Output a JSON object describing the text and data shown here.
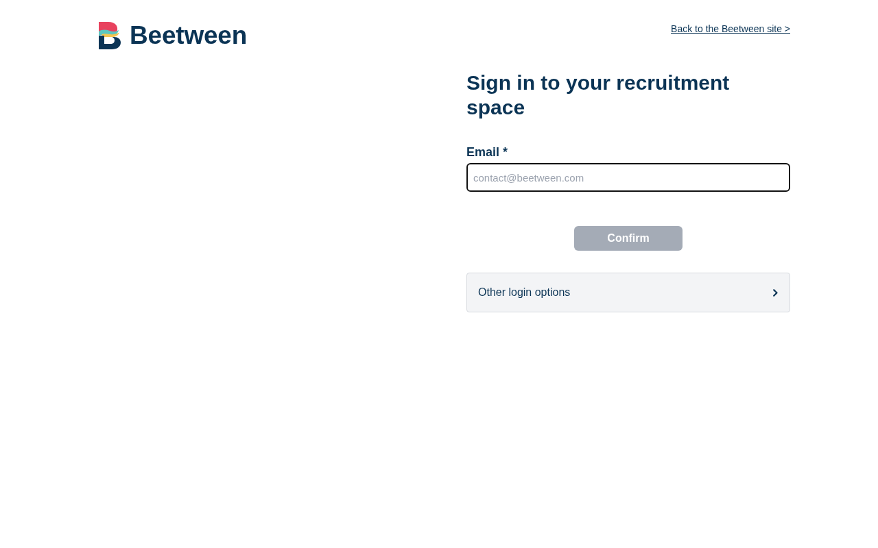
{
  "header": {
    "logo": {
      "text": "Beetween"
    },
    "back_link": "Back to the Beetween site >"
  },
  "form": {
    "title": "Sign in to your recruitment space",
    "email": {
      "label": "Email *",
      "placeholder": "contact@beetween.com",
      "focused": true
    },
    "confirm_button": {
      "label": "Confirm",
      "disabled": true
    },
    "other_options": {
      "label": "Other login options",
      "expanded": false
    }
  }
}
